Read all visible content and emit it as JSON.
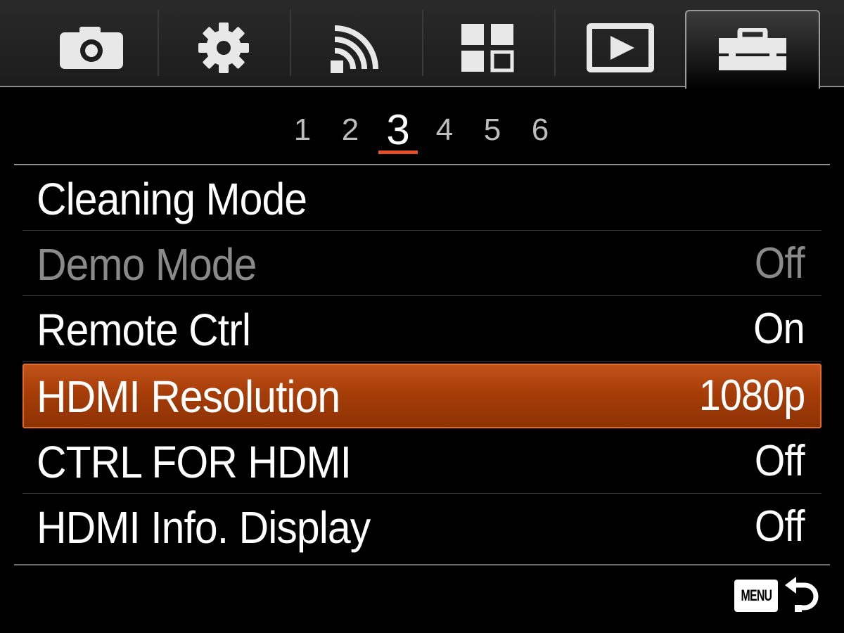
{
  "tabs": [
    {
      "name": "camera-icon",
      "active": false
    },
    {
      "name": "gear-icon",
      "active": false
    },
    {
      "name": "wireless-icon",
      "active": false
    },
    {
      "name": "applications-icon",
      "active": false
    },
    {
      "name": "playback-icon",
      "active": false
    },
    {
      "name": "toolbox-icon",
      "active": true
    }
  ],
  "pages": [
    "1",
    "2",
    "3",
    "4",
    "5",
    "6"
  ],
  "current_page": "3",
  "menu": {
    "items": [
      {
        "label": "Cleaning Mode",
        "value": ""
      },
      {
        "label": "Demo Mode",
        "value": "Off",
        "state": "disabled"
      },
      {
        "label": "Remote Ctrl",
        "value": "On"
      },
      {
        "label": "HDMI Resolution",
        "value": "1080p",
        "state": "selected"
      },
      {
        "label": "CTRL FOR HDMI",
        "value": "Off"
      },
      {
        "label": "HDMI Info. Display",
        "value": "Off"
      }
    ]
  },
  "footer": {
    "menu_label": "MENU",
    "back_icon": "return-arrow-icon"
  },
  "colors": {
    "accent": "#e4502a",
    "selected_bg": "#a63d08",
    "disabled_text": "#8a8a8a"
  }
}
